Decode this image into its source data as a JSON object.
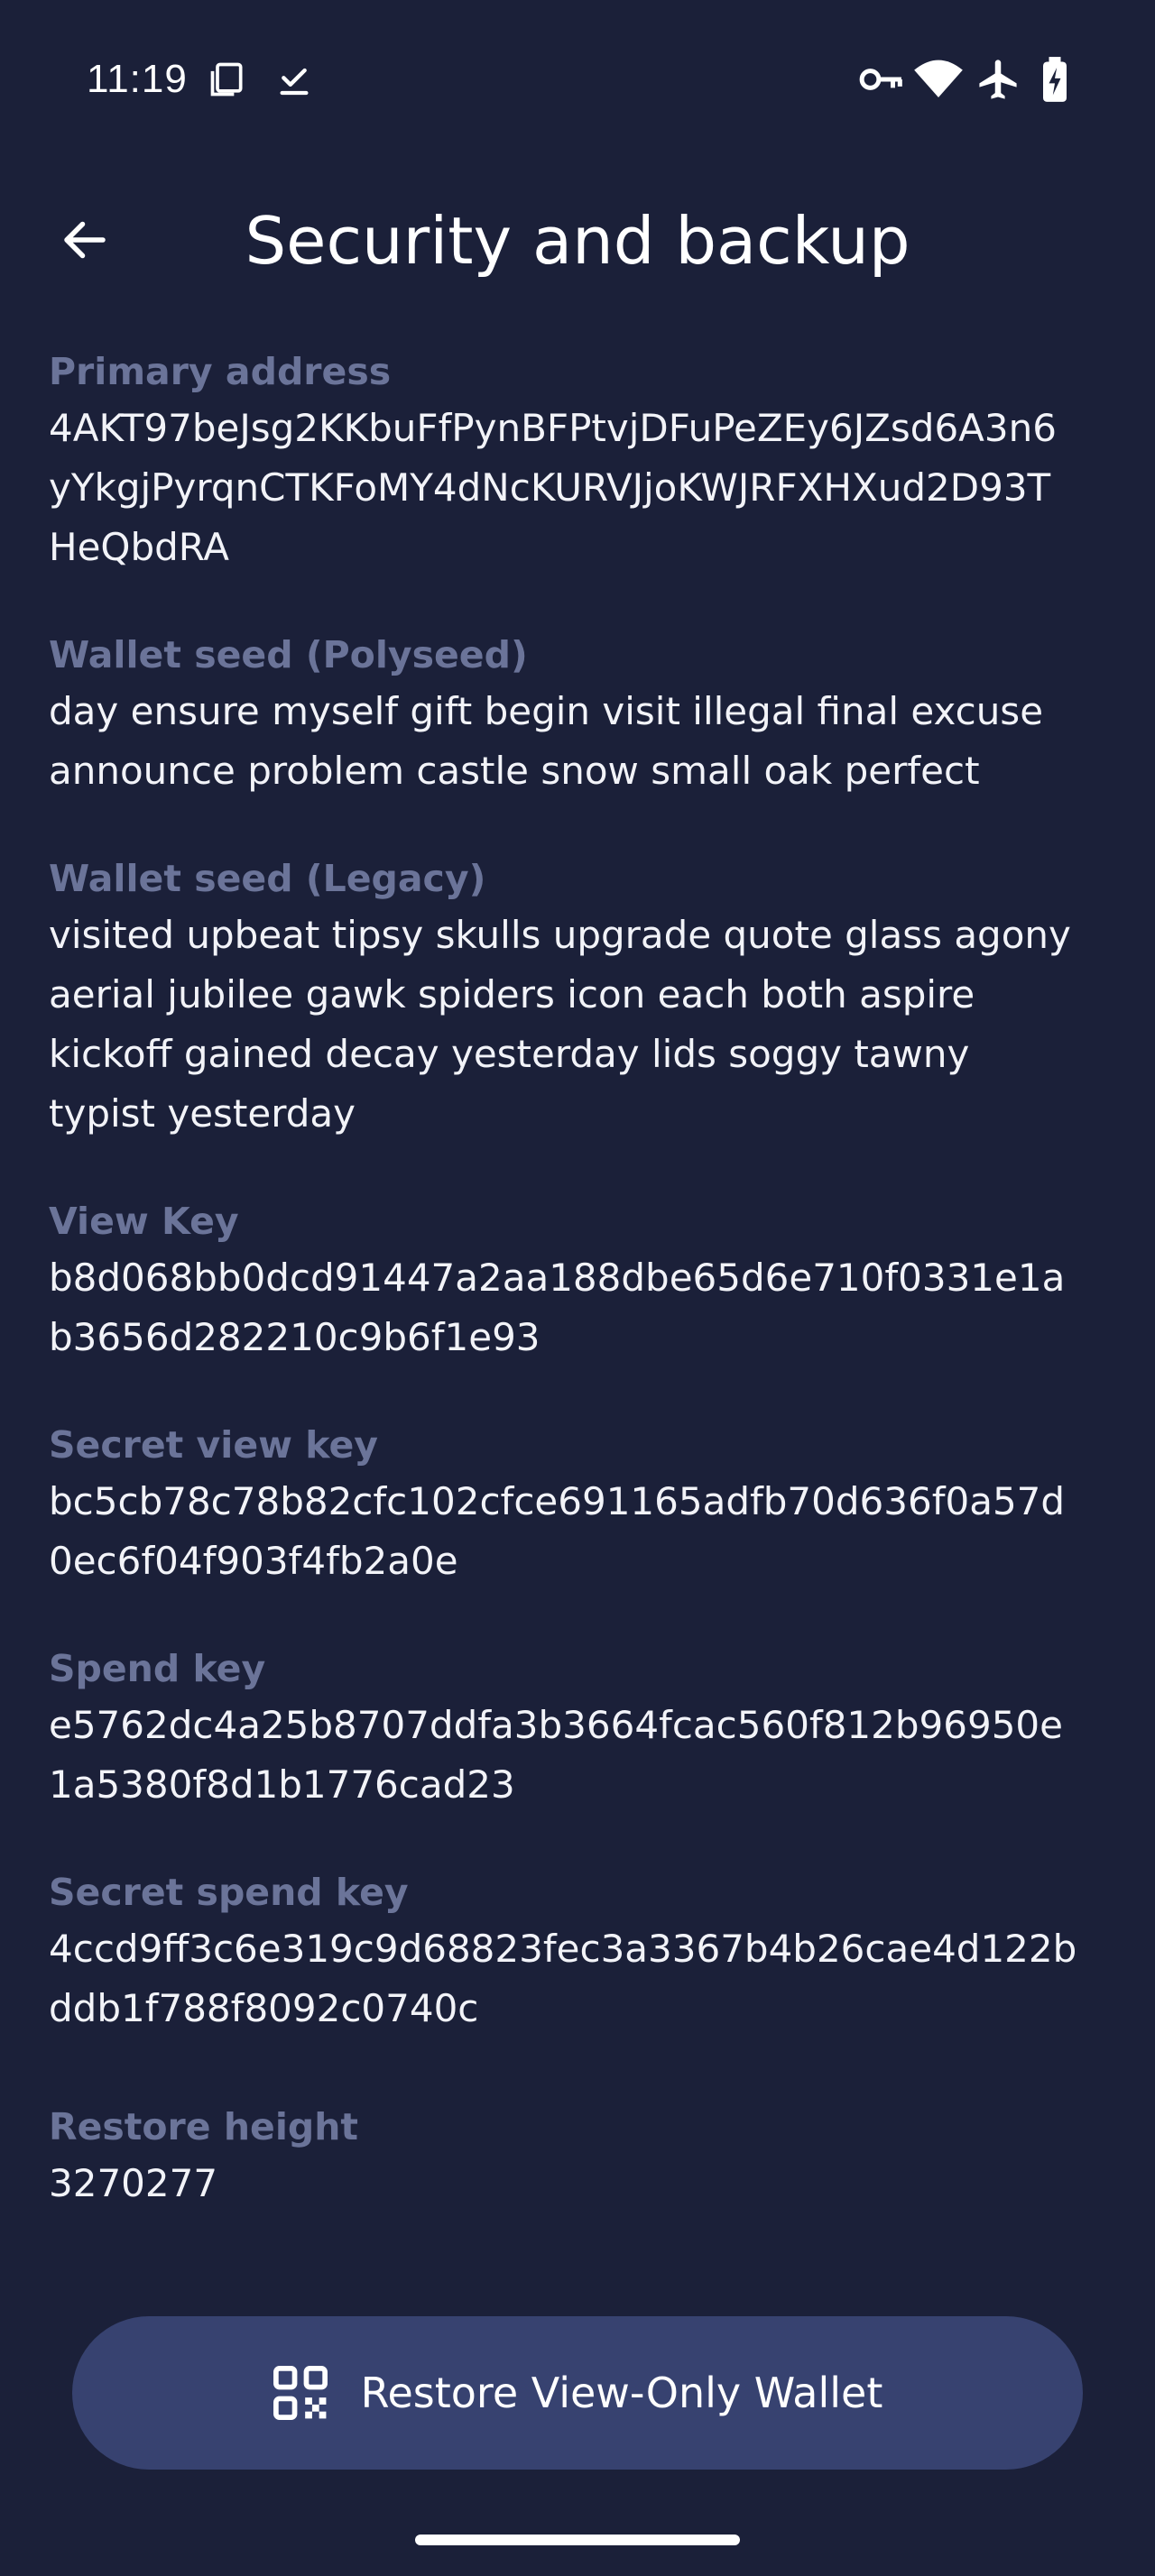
{
  "status_bar": {
    "time": "11:19",
    "icons": [
      "screenshot-icon",
      "check-icon",
      "vpn-key-icon",
      "wifi-icon",
      "airplane-icon",
      "battery-charging-icon"
    ]
  },
  "app_bar": {
    "back_icon": "arrow-left-icon",
    "title": "Security and backup"
  },
  "fields": {
    "primary_address": {
      "label": "Primary address",
      "value": "4AKT97beJsg2KKbuFfPynBFPtvjDFuPeZEy6JZsd6A3n6yYkgjPyrqnCTKFoMY4dNcKURVJjoKWJRFXHXud2D93THeQbdRA"
    },
    "seed_polyseed": {
      "label": "Wallet seed (Polyseed)",
      "value": "day ensure myself gift begin visit illegal final excuse announce problem castle snow small oak perfect"
    },
    "seed_legacy": {
      "label": "Wallet seed (Legacy)",
      "value": "visited upbeat tipsy skulls upgrade quote glass agony aerial jubilee gawk spiders icon each both aspire kickoff gained decay yesterday lids soggy tawny typist yesterday"
    },
    "view_key": {
      "label": "View Key",
      "value": "b8d068bb0dcd91447a2aa188dbe65d6e710f0331e1ab3656d282210c9b6f1e93"
    },
    "secret_view_key": {
      "label": "Secret view key",
      "value": "bc5cb78c78b82cfc102cfce691165adfb70d636f0a57d0ec6f04f903f4fb2a0e"
    },
    "spend_key": {
      "label": "Spend key",
      "value": "e5762dc4a25b8707ddfa3b3664fcac560f812b96950e1a5380f8d1b1776cad23"
    },
    "secret_spend_key": {
      "label": "Secret spend key",
      "value": "4ccd9ff3c6e319c9d68823fec3a3367b4b26cae4d122bddb1f788f8092c0740c"
    },
    "restore_height": {
      "label": "Restore height",
      "value": "3270277"
    }
  },
  "restore_button": {
    "icon": "qr-code-icon",
    "label": "Restore View-Only Wallet"
  },
  "colors": {
    "background": "#1b2039",
    "label": "#6b7499",
    "value": "#f2f3f8",
    "button": "#374270"
  }
}
